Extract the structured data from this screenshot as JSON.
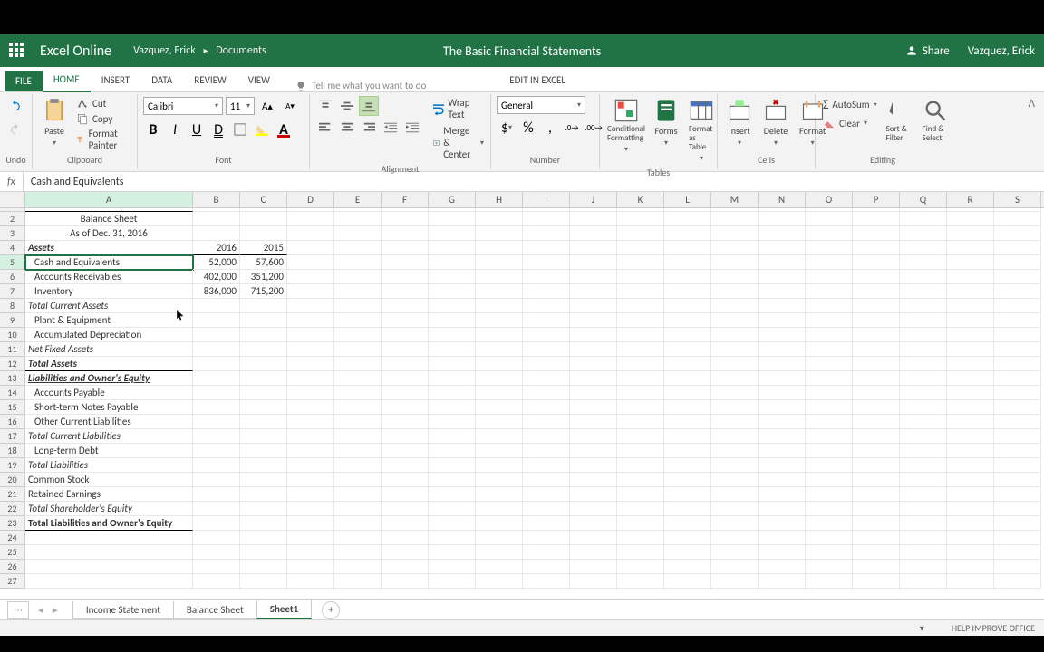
{
  "titlebar": {
    "app_name": "Excel Online",
    "user_crumb": "Vazquez, Erick",
    "folder_crumb": "Documents",
    "doc_title": "The Basic Financial Statements",
    "share_label": "Share",
    "user_name": "Vazquez, Erick"
  },
  "tabs": {
    "file": "FILE",
    "home": "HOME",
    "insert": "INSERT",
    "data": "DATA",
    "review": "REVIEW",
    "view": "VIEW",
    "tell_me": "Tell me what you want to do",
    "edit_excel": "EDIT IN EXCEL"
  },
  "ribbon": {
    "undo": {
      "label": "Undo"
    },
    "clipboard": {
      "paste": "Paste",
      "cut": "Cut",
      "copy": "Copy",
      "format_painter": "Format Painter",
      "label": "Clipboard"
    },
    "font": {
      "name": "Calibri",
      "size": "11",
      "label": "Font"
    },
    "alignment": {
      "wrap": "Wrap Text",
      "merge": "Merge & Center",
      "label": "Alignment"
    },
    "number": {
      "format": "General",
      "label": "Number"
    },
    "tables": {
      "conditional": "Conditional Formatting",
      "forms": "Forms",
      "as_table": "Format as Table",
      "label": "Tables"
    },
    "cells": {
      "insert": "Insert",
      "delete": "Delete",
      "format": "Format",
      "label": "Cells"
    },
    "editing": {
      "autosum": "AutoSum",
      "clear": "Clear",
      "sort": "Sort & Filter",
      "find": "Find & Select",
      "label": "Editing"
    }
  },
  "formula_bar": {
    "value": "Cash and Equivalents"
  },
  "columns": [
    "A",
    "B",
    "C",
    "D",
    "E",
    "F",
    "G",
    "H",
    "I",
    "J",
    "K",
    "L",
    "M",
    "N",
    "O",
    "P",
    "Q",
    "R",
    "S"
  ],
  "rows": {
    "r2": {
      "a": "Balance Sheet"
    },
    "r3": {
      "a": "As of Dec. 31, 2016"
    },
    "r4": {
      "a": "Assets",
      "b": "2016",
      "c": "2015"
    },
    "r5": {
      "a": "Cash and Equivalents",
      "b": "52,000",
      "c": "57,600"
    },
    "r6": {
      "a": "Accounts Receivables",
      "b": "402,000",
      "c": "351,200"
    },
    "r7": {
      "a": "Inventory",
      "b": "836,000",
      "c": "715,200"
    },
    "r8": {
      "a": "Total Current Assets"
    },
    "r9": {
      "a": "Plant & Equipment"
    },
    "r10": {
      "a": "Accumulated Depreciation"
    },
    "r11": {
      "a": "Net Fixed Assets"
    },
    "r12": {
      "a": "Total Assets"
    },
    "r13": {
      "a": "Liabilities and Owner's Equity"
    },
    "r14": {
      "a": "Accounts Payable"
    },
    "r15": {
      "a": "Short-term Notes Payable"
    },
    "r16": {
      "a": "Other Current Liabilities"
    },
    "r17": {
      "a": "Total Current Liabilities"
    },
    "r18": {
      "a": "Long-term Debt"
    },
    "r19": {
      "a": "Total Liabilities"
    },
    "r20": {
      "a": "Common Stock"
    },
    "r21": {
      "a": "Retained Earnings"
    },
    "r22": {
      "a": "Total Shareholder's Equity"
    },
    "r23": {
      "a": "Total Liabilities and Owner's Equity"
    }
  },
  "row_nums": [
    "2",
    "3",
    "4",
    "5",
    "6",
    "7",
    "8",
    "9",
    "10",
    "11",
    "12",
    "13",
    "14",
    "15",
    "16",
    "17",
    "18",
    "19",
    "20",
    "21",
    "22",
    "23",
    "24",
    "25",
    "26",
    "27"
  ],
  "sheets": {
    "income": "Income Statement",
    "balance": "Balance Sheet",
    "sheet1": "Sheet1"
  },
  "status": {
    "help": "HELP IMPROVE OFFICE"
  }
}
